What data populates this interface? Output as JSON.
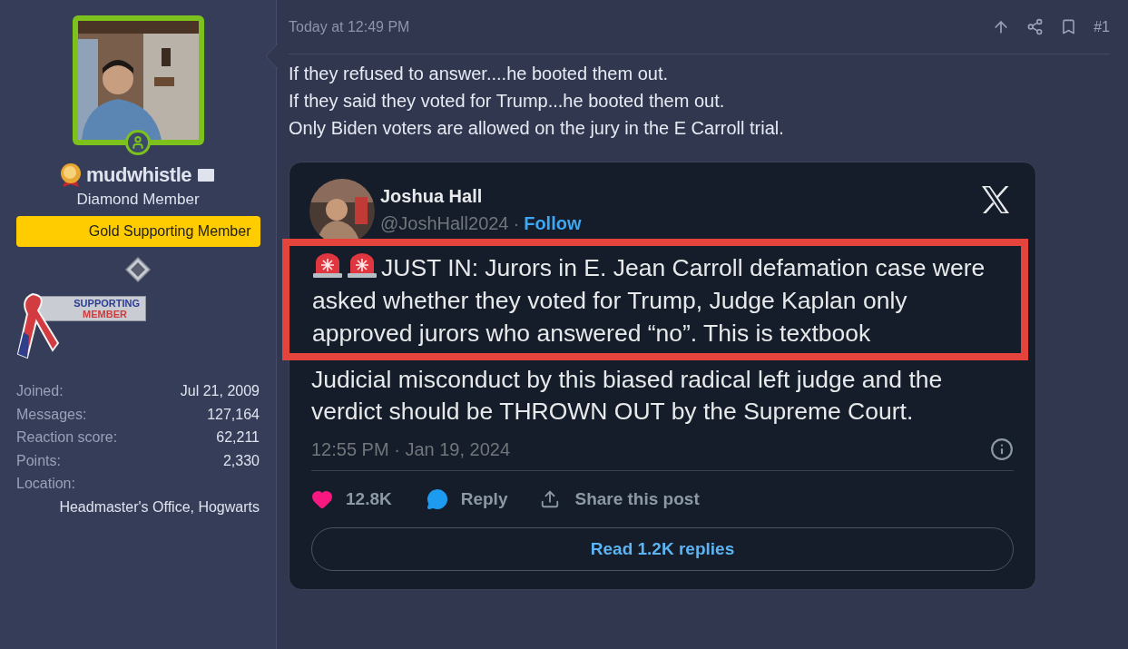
{
  "user": {
    "name": "mudwhistle",
    "title": "Diamond Member",
    "banner": "Gold Supporting Member",
    "award_lines": [
      "SUPPORTING",
      "MEMBER"
    ],
    "stats": [
      {
        "label": "Joined:",
        "value": "Jul 21, 2009"
      },
      {
        "label": "Messages:",
        "value": "127,164"
      },
      {
        "label": "Reaction score:",
        "value": "62,211"
      },
      {
        "label": "Points:",
        "value": "2,330"
      }
    ],
    "location_label": "Location:",
    "location": "Headmaster's Office, Hogwarts"
  },
  "post": {
    "time": "Today at 12:49 PM",
    "number": "#1",
    "lines": [
      "If they refused to answer....he booted them out.",
      "If they said they voted for Trump...he booted them out.",
      "Only Biden voters are allowed on the jury in the E Carroll trial."
    ],
    "embed": {
      "author": "Joshua Hall",
      "handle": "@JoshHall2024",
      "separator": "·",
      "follow": "Follow",
      "highlighted_text": "JUST IN: Jurors in E. Jean Carroll defamation case were asked whether they voted for Trump, Judge Kaplan only approved jurors who answered “no”. This is textbook",
      "rest_text": "Judicial misconduct by this biased radical left judge and the verdict should be THROWN OUT by the Supreme Court.",
      "timestamp": "12:55 PM · Jan 19, 2024",
      "likes": "12.8K",
      "reply": "Reply",
      "share": "Share this post",
      "read_replies": "Read 1.2K replies"
    }
  }
}
